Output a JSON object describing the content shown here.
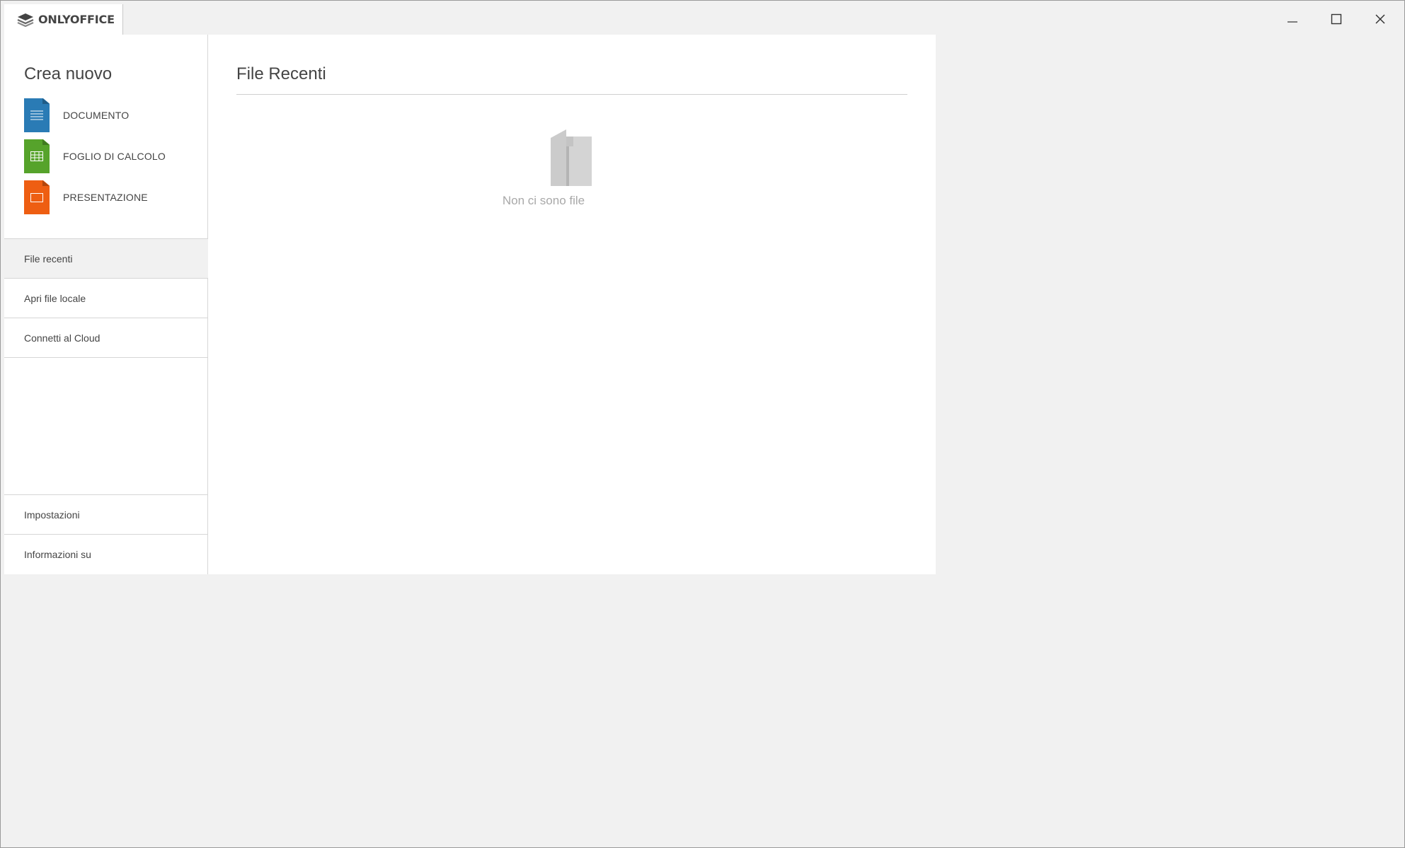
{
  "titlebar": {
    "brand": "ONLYOFFICE",
    "controls": {
      "minimize_icon": "minimize-icon",
      "maximize_icon": "maximize-icon",
      "close_icon": "close-icon"
    }
  },
  "sidebar": {
    "create_title": "Crea nuovo",
    "create_items": [
      {
        "label": "DOCUMENTO",
        "icon": "document-icon",
        "color": "#2a7bb5"
      },
      {
        "label": "FOGLIO DI CALCOLO",
        "icon": "spreadsheet-icon",
        "color": "#56a32b"
      },
      {
        "label": "PRESENTAZIONE",
        "icon": "presentation-icon",
        "color": "#ee5e12"
      }
    ],
    "nav_items": [
      {
        "label": "File recenti",
        "active": true
      },
      {
        "label": "Apri file locale",
        "active": false
      },
      {
        "label": "Connetti al Cloud",
        "active": false
      }
    ],
    "bottom_items": [
      {
        "label": "Impostazioni"
      },
      {
        "label": "Informazioni su"
      }
    ]
  },
  "content": {
    "title": "File Recenti",
    "empty_text": "Non ci sono file",
    "empty_icon": "empty-folder-icon"
  }
}
